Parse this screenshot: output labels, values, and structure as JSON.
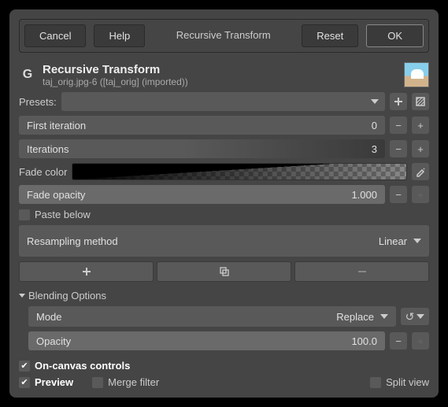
{
  "buttons": {
    "cancel": "Cancel",
    "help": "Help",
    "title": "Recursive Transform",
    "reset": "Reset",
    "ok": "OK"
  },
  "header": {
    "title": "Recursive Transform",
    "subtitle": "taj_orig.jpg-6 ([taj_orig] (imported))"
  },
  "presets": {
    "label": "Presets:"
  },
  "first_iter": {
    "label": "First iteration",
    "value": "0"
  },
  "iterations": {
    "label": "Iterations",
    "value": "3"
  },
  "fade_color": {
    "label": "Fade color"
  },
  "fade_opacity": {
    "label": "Fade opacity",
    "value": "1.000"
  },
  "paste_below": {
    "label": "Paste below"
  },
  "resampling": {
    "label": "Resampling method",
    "value": "Linear"
  },
  "blending": {
    "header": "Blending Options",
    "mode_label": "Mode",
    "mode_value": "Replace",
    "opacity_label": "Opacity",
    "opacity_value": "100.0"
  },
  "oncanvas": {
    "label": "On-canvas controls"
  },
  "preview": {
    "label": "Preview"
  },
  "merge": {
    "label": "Merge filter"
  },
  "split": {
    "label": "Split view"
  }
}
